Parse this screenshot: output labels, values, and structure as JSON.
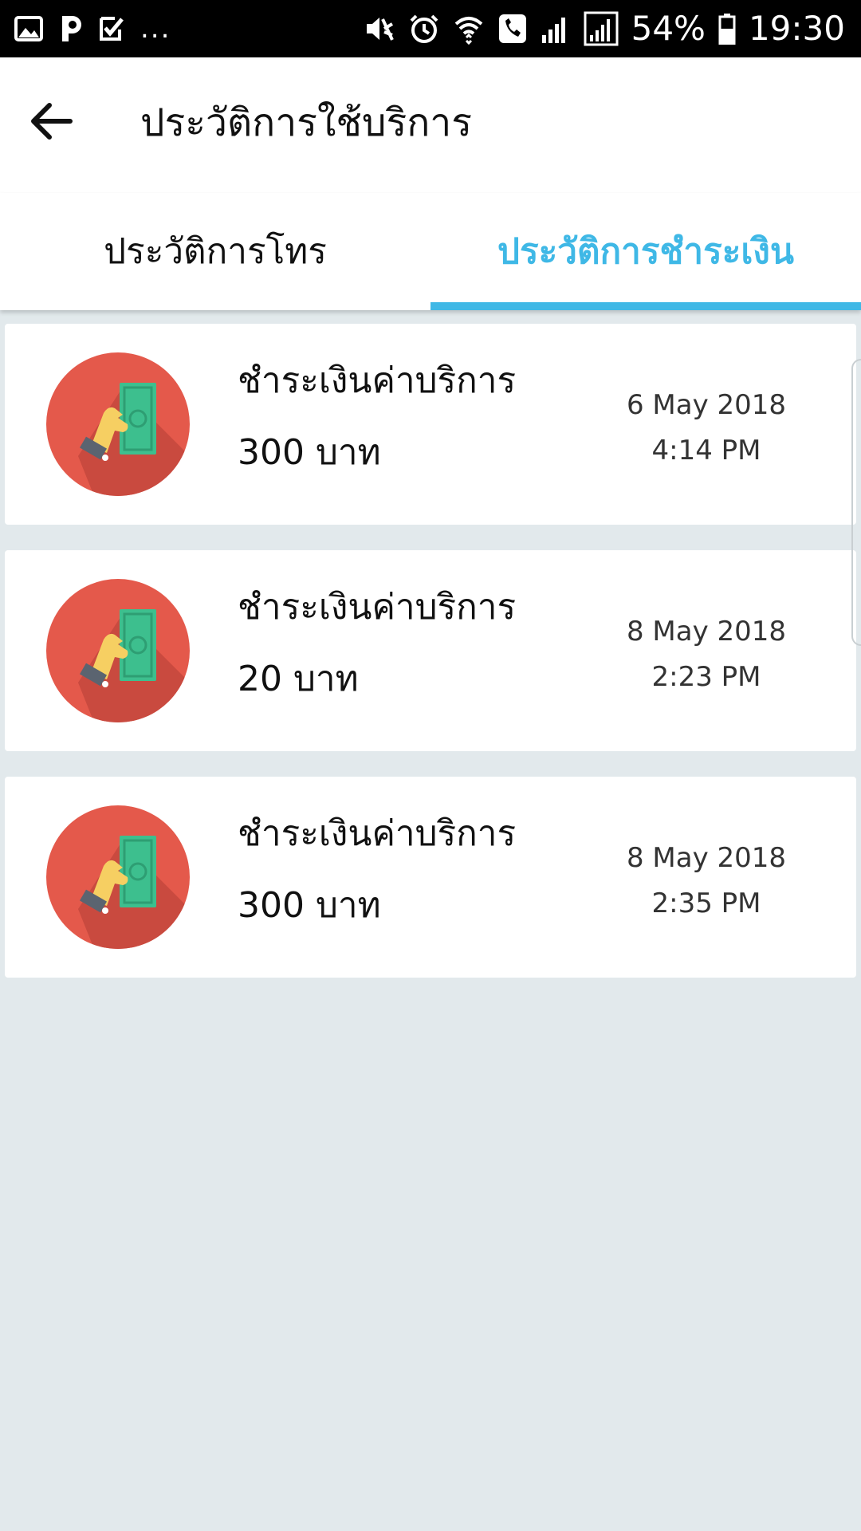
{
  "status_bar": {
    "battery_percent": "54%",
    "time": "19:30",
    "more": "...",
    "icons": [
      "gallery-icon",
      "p-app-icon",
      "checkbox-app-icon",
      "mute-icon",
      "alarm-icon",
      "wifi-icon",
      "call-icon",
      "signal-icon",
      "signal-icon",
      "battery-icon"
    ]
  },
  "app_bar": {
    "title": "ประวัติการใช้บริการ",
    "back_icon": "arrow-left-icon"
  },
  "tabs": [
    {
      "label": "ประวัติการโทร",
      "active": false
    },
    {
      "label": "ประวัติการชำระเงิน",
      "active": true
    }
  ],
  "colors": {
    "accent": "#3fb8e6",
    "background": "#e2e9ec",
    "icon_circle": "#e4594b"
  },
  "payments": [
    {
      "icon": "payment-hand-money-icon",
      "title": "ชำระเงินค่าบริการ",
      "amount": "300 บาท",
      "date": "6 May 2018",
      "time": "4:14 PM"
    },
    {
      "icon": "payment-hand-money-icon",
      "title": "ชำระเงินค่าบริการ",
      "amount": "20 บาท",
      "date": "8 May 2018",
      "time": "2:23 PM"
    },
    {
      "icon": "payment-hand-money-icon",
      "title": "ชำระเงินค่าบริการ",
      "amount": "300 บาท",
      "date": "8 May 2018",
      "time": "2:35 PM"
    }
  ]
}
